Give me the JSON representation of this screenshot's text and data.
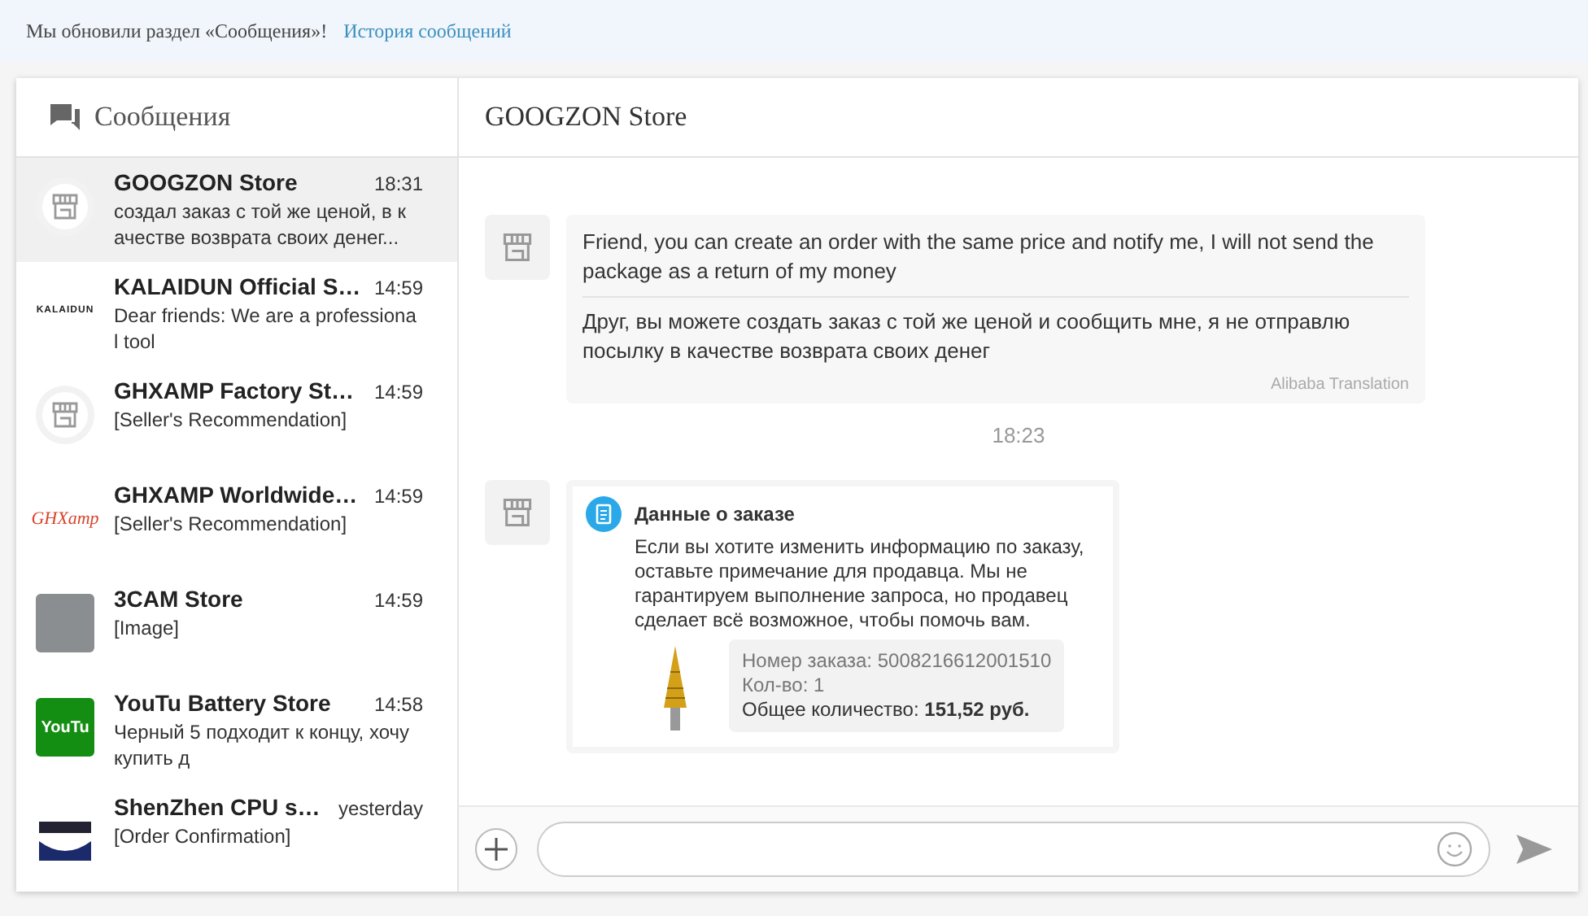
{
  "banner": {
    "text": "Мы обновили раздел «Сообщения»!",
    "link": "История сообщений"
  },
  "sidebar": {
    "title": "Сообщения",
    "conversations": [
      {
        "name": "GOOGZON Store",
        "time": "18:31",
        "preview": "создал заказ с той же ценой, в к ачестве возврата своих денег...",
        "avatar": {
          "kind": "store"
        },
        "selected": true
      },
      {
        "name": "KALAIDUN Official S…",
        "time": "14:59",
        "preview": "Dear friends: We are a professiona l tool",
        "avatar": {
          "kind": "wordmark",
          "text": "KALAIDUN"
        },
        "selected": false
      },
      {
        "name": "GHXAMP Factory St…",
        "time": "14:59",
        "preview": "[Seller's Recommendation]",
        "avatar": {
          "kind": "store"
        },
        "selected": false
      },
      {
        "name": "GHXAMP Worldwide…",
        "time": "14:59",
        "preview": "[Seller's Recommendation]",
        "avatar": {
          "kind": "script",
          "text": "GHXamp"
        },
        "selected": false
      },
      {
        "name": "3CAM Store",
        "time": "14:59",
        "preview": "[Image]",
        "avatar": {
          "kind": "photo"
        },
        "selected": false
      },
      {
        "name": "YouTu Battery Store",
        "time": "14:58",
        "preview": "Черный 5 подходит к концу, хочу купить д",
        "avatar": {
          "kind": "badge",
          "text": "YouTu"
        },
        "selected": false
      },
      {
        "name": "ShenZhen CPU s…",
        "time": "yesterday",
        "preview": "[Order Confirmation]",
        "avatar": {
          "kind": "product"
        },
        "selected": false
      }
    ]
  },
  "chat": {
    "title": "GOOGZON Store",
    "items": [
      {
        "kind": "message",
        "original": "Friend, you can create an order with the same price and notify me, I will not send the package as a return of my money",
        "translation": "Друг, вы можете создать заказ с той же ценой и сообщить мне, я не отправлю посылку в качестве возврата своих денег",
        "source": "Alibaba Translation"
      },
      {
        "kind": "time",
        "text": "18:23"
      },
      {
        "kind": "order",
        "title": "Данные о заказе",
        "body": "Если вы хотите изменить информацию по заказу, оставьте примечание для продавца. Мы не гарантируем выполнение запроса, но продавец сделает всё возможное, чтобы помочь вам.",
        "details": [
          "Номер заказа: 5008216612001510",
          "Кол-во: 1",
          "Общее количество: **151,52 руб.**"
        ]
      }
    ]
  }
}
